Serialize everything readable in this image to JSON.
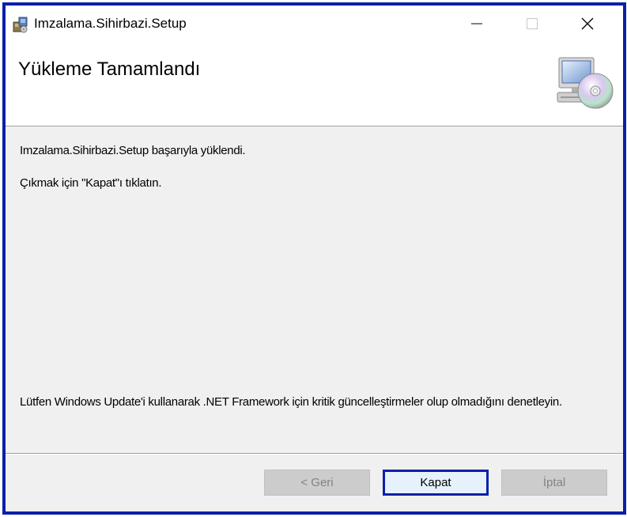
{
  "window": {
    "title": "Imzalama.Sihirbazi.Setup",
    "minimize_glyph": "—",
    "maximize_glyph": "☐",
    "close_glyph": "✕"
  },
  "header": {
    "title": "Yükleme Tamamlandı",
    "graphic_icon": "computer-cd-icon"
  },
  "content": {
    "success_message": "Imzalama.Sihirbazi.Setup başarıyla yüklendi.",
    "instruction": "Çıkmak için \"Kapat\"ı tıklatın.",
    "update_note": "Lütfen Windows Update'i kullanarak .NET Framework için kritik güncelleştirmeler olup olmadığını denetleyin."
  },
  "buttons": {
    "back": "< Geri",
    "close": "Kapat",
    "cancel": "İptal"
  },
  "colors": {
    "focus_border": "#0a20a8",
    "dialog_bg": "#f0f0f0",
    "disabled_text": "#838383"
  }
}
